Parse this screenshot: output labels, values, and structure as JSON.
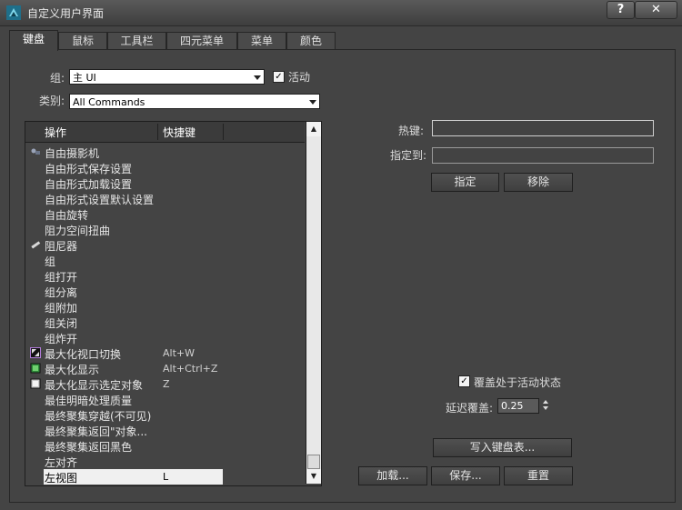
{
  "window": {
    "title": "自定义用户界面",
    "help_label": "?",
    "close_label": "✕"
  },
  "tabs": [
    {
      "label": "键盘",
      "active": true
    },
    {
      "label": "鼠标",
      "active": false
    },
    {
      "label": "工具栏",
      "active": false
    },
    {
      "label": "四元菜单",
      "active": false
    },
    {
      "label": "菜单",
      "active": false
    },
    {
      "label": "颜色",
      "active": false
    }
  ],
  "group": {
    "label": "组:",
    "value": "主 UI",
    "active_label": "活动",
    "active_checked": "✓"
  },
  "category": {
    "label": "类别:",
    "value": "All Commands"
  },
  "list": {
    "col_action": "操作",
    "col_shortcut": "快捷键",
    "rows": [
      {
        "action": "自由摄影机",
        "shortcut": "",
        "icon": "camera-icon"
      },
      {
        "action": "自由形式保存设置",
        "shortcut": ""
      },
      {
        "action": "自由形式加载设置",
        "shortcut": ""
      },
      {
        "action": "自由形式设置默认设置",
        "shortcut": ""
      },
      {
        "action": "自由旋转",
        "shortcut": ""
      },
      {
        "action": "阻力空间扭曲",
        "shortcut": ""
      },
      {
        "action": "阻尼器",
        "shortcut": "",
        "icon": "damper-icon"
      },
      {
        "action": "组",
        "shortcut": ""
      },
      {
        "action": "组打开",
        "shortcut": ""
      },
      {
        "action": "组分离",
        "shortcut": ""
      },
      {
        "action": "组附加",
        "shortcut": ""
      },
      {
        "action": "组关闭",
        "shortcut": ""
      },
      {
        "action": "组炸开",
        "shortcut": ""
      },
      {
        "action": "最大化视口切换",
        "shortcut": "Alt+W",
        "icon": "maximize-viewport-icon"
      },
      {
        "action": "最大化显示",
        "shortcut": "Alt+Ctrl+Z",
        "icon": "zoom-extents-icon"
      },
      {
        "action": "最大化显示选定对象",
        "shortcut": "Z",
        "icon": "zoom-selected-icon"
      },
      {
        "action": "最佳明暗处理质量",
        "shortcut": ""
      },
      {
        "action": "最终聚集穿越(不可见)",
        "shortcut": ""
      },
      {
        "action": "最终聚集返回\"对象...",
        "shortcut": ""
      },
      {
        "action": "最终聚集返回黑色",
        "shortcut": ""
      },
      {
        "action": "左对齐",
        "shortcut": ""
      },
      {
        "action": "左视图",
        "shortcut": "L",
        "selected": true
      }
    ]
  },
  "hotkey": {
    "label": "热键:",
    "value": "",
    "assigned_label": "指定到:",
    "assigned_value": "",
    "assign_button": "指定",
    "remove_button": "移除"
  },
  "override": {
    "checked": "✓",
    "label": "覆盖处于活动状态",
    "delay_label": "延迟覆盖:",
    "delay_value": "0.25"
  },
  "buttons": {
    "write_table": "写入键盘表...",
    "load": "加载...",
    "save": "保存...",
    "reset": "重置"
  },
  "colors": {
    "background": "#444444",
    "selection": "#f0f0f0"
  }
}
